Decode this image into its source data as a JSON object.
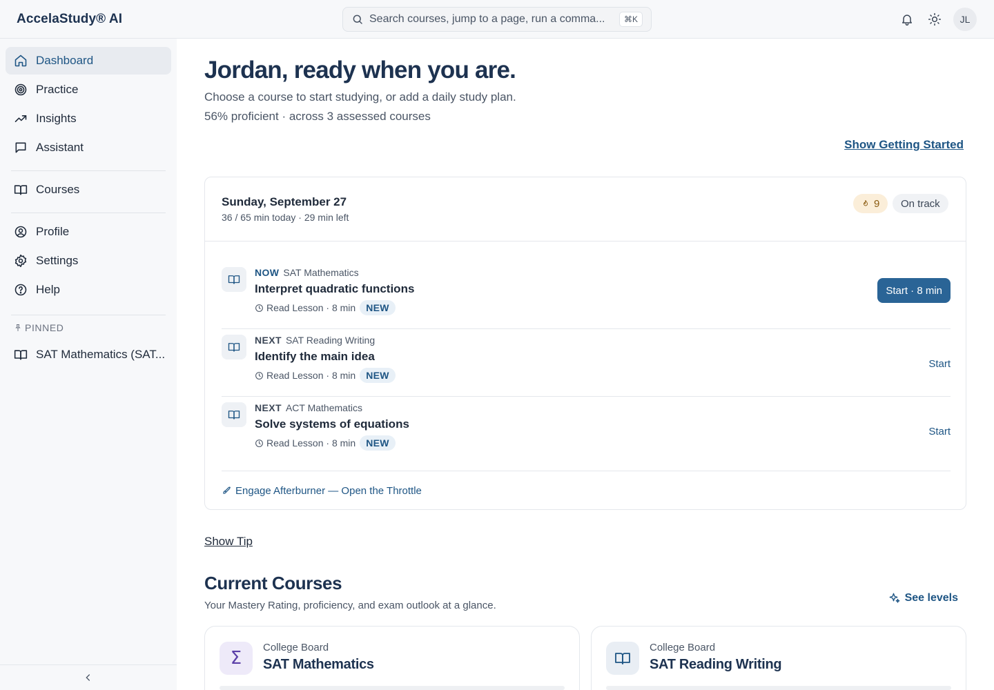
{
  "app": {
    "brand": "AccelaStudy® AI"
  },
  "search": {
    "placeholder": "Search courses, jump to a page, run a comma...",
    "shortcut": "⌘K"
  },
  "header": {
    "avatar_initials": "JL"
  },
  "sidebar": {
    "items": [
      {
        "label": "Dashboard",
        "icon": "home-icon",
        "active": true
      },
      {
        "label": "Practice",
        "icon": "target-icon"
      },
      {
        "label": "Insights",
        "icon": "trending-up-icon"
      },
      {
        "label": "Assistant",
        "icon": "chat-icon"
      },
      {
        "label": "Courses",
        "icon": "book-icon"
      },
      {
        "label": "Profile",
        "icon": "user-circle-icon"
      },
      {
        "label": "Settings",
        "icon": "gear-icon"
      },
      {
        "label": "Help",
        "icon": "help-icon"
      }
    ],
    "pinned_label": "PINNED",
    "pinned": [
      {
        "label": "SAT Mathematics (SAT...",
        "icon": "book-icon"
      }
    ]
  },
  "main": {
    "greeting": "Jordan, ready when you are.",
    "subtitle": "Choose a course to start studying, or add a daily study plan.",
    "proficiency": "56% proficient · across 3 assessed courses",
    "getting_started": "Show Getting Started",
    "plan": {
      "date": "Sunday, September 27",
      "meta": "36 / 65 min today · 29 min left",
      "streak": "9",
      "status": "On track",
      "tasks": [
        {
          "tag": "NOW",
          "course": "SAT Mathematics",
          "title": "Interpret quadratic functions",
          "meta": "Read Lesson · 8 min",
          "badge": "NEW",
          "action": "Start · 8 min"
        },
        {
          "tag": "NEXT",
          "course": "SAT Reading Writing",
          "title": "Identify the main idea",
          "meta": "Read Lesson · 8 min",
          "badge": "NEW",
          "action": "Start"
        },
        {
          "tag": "NEXT",
          "course": "ACT Mathematics",
          "title": "Solve systems of equations",
          "meta": "Read Lesson · 8 min",
          "badge": "NEW",
          "action": "Start"
        }
      ],
      "footer_link": "Engage Afterburner — Open the Throttle"
    },
    "show_tip": "Show Tip",
    "courses_section": {
      "title": "Current Courses",
      "subtitle": "Your Mastery Rating, proficiency, and exam outlook at a glance.",
      "see_levels": "See levels",
      "cards": [
        {
          "org": "College Board",
          "name": "SAT Mathematics",
          "icon": "sigma-icon",
          "icon_bg": "#eeeaf9",
          "icon_color": "#5b3fa8"
        },
        {
          "org": "College Board",
          "name": "SAT Reading Writing",
          "icon": "book-icon",
          "icon_bg": "#e9eef4",
          "icon_color": "#1e5584"
        }
      ]
    }
  },
  "colors": {
    "accent": "#1e5584",
    "primary_button": "#2a6496",
    "heading": "#1d3250"
  }
}
